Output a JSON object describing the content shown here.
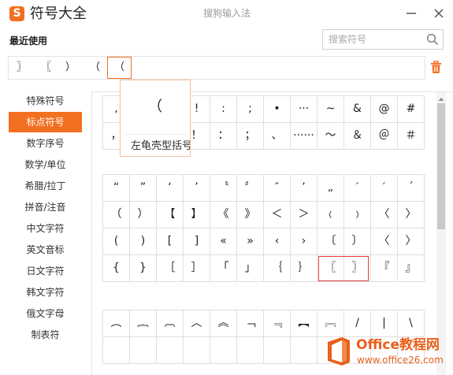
{
  "title_bar": {
    "logo_letter": "S",
    "title": "符号大全",
    "app_name": "搜狗输入法",
    "minimize_icon": "minimize-icon",
    "close_icon": "close-icon"
  },
  "recent": {
    "label": "最近使用",
    "items": [
      "〗",
      "〖",
      "）",
      "（",
      "（"
    ],
    "highlighted_index": 4,
    "clear_icon": "trash-icon"
  },
  "search": {
    "placeholder": "搜索符号",
    "value": "",
    "icon": "search-icon"
  },
  "tooltip": {
    "symbol": "（",
    "name": "左龟壳型括号"
  },
  "categories": [
    "特殊符号",
    "标点符号",
    "数字序号",
    "数学/单位",
    "希腊/拉丁",
    "拼音/注音",
    "中文字符",
    "英文音标",
    "日文字符",
    "韩文字符",
    "俄文字母",
    "制表符"
  ],
  "selected_category_index": 1,
  "grids": [
    [
      [
        ",",
        "",
        "",
        "!",
        ":",
        ";",
        "•",
        "···",
        "~",
        "&",
        "@",
        "#"
      ],
      [
        "，",
        "",
        "",
        "！",
        "：",
        "；",
        "、",
        "······",
        "～",
        "＆",
        "＠",
        "＃"
      ]
    ],
    [
      [
        "“",
        "”",
        "‘",
        "’",
        "〝",
        "〞",
        "″",
        "’",
        "„",
        "′",
        "′",
        "ˊ"
      ],
      [
        "（",
        "）",
        "【",
        "】",
        "《",
        "》",
        "＜",
        "＞",
        "﹙",
        "﹚",
        "〈",
        "〉"
      ],
      [
        "(",
        ")",
        "[",
        "]",
        "«",
        "»",
        "‹",
        "›",
        "〔",
        "〕",
        "〈",
        "〉"
      ],
      [
        "{",
        "}",
        "［",
        "］",
        "「",
        "」",
        "｛",
        "｝",
        "〖",
        "〗",
        "『",
        "』"
      ]
    ],
    [
      [
        "︵",
        "︷",
        "︹",
        "︿",
        "︽",
        "﹁",
        "﹃",
        "︻",
        "︗",
        "/",
        "|",
        "\\"
      ],
      [
        "",
        "",
        "",
        "",
        "",
        "",
        "",
        "",
        "",
        "",
        "",
        ""
      ]
    ]
  ],
  "colors": {
    "accent": "#f36f21",
    "selection_box": "#e23b3b",
    "watermark": "#e8601c"
  },
  "watermark": {
    "brand": "Office教程网",
    "url": "www.office26.com"
  }
}
